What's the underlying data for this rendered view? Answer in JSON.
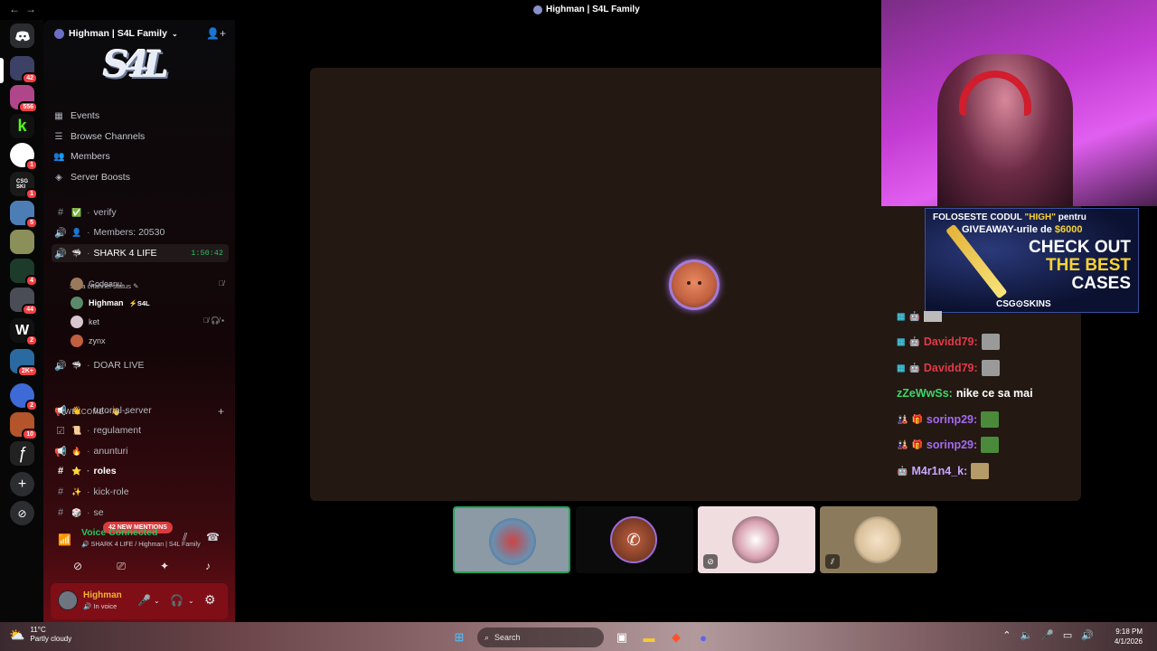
{
  "window": {
    "title": "Highman | S4L Family",
    "back": "←",
    "forward": "→"
  },
  "rail": {
    "badges": [
      "42",
      "556",
      "1",
      "1",
      "5",
      "4",
      "44",
      "2",
      "2K+",
      "2",
      "10"
    ]
  },
  "sidebar": {
    "server_name": "Highman | S4L Family",
    "banner_text": "S4L",
    "menu": [
      {
        "label": "Events",
        "icon": "calendar-icon"
      },
      {
        "label": "Browse Channels",
        "icon": "browse-icon"
      },
      {
        "label": "Members",
        "icon": "members-icon"
      },
      {
        "label": "Server Boosts",
        "icon": "boost-icon"
      }
    ],
    "channels": {
      "verify": "verify",
      "members_count": "Members: 20530",
      "shark": "SHARK 4 LIFE",
      "shark_timer": "1:50:42",
      "shark_status": "Set a channel status",
      "doar_live": "DOAR LIVE"
    },
    "voice_users": [
      {
        "name": "Godeanu",
        "tag": ""
      },
      {
        "name": "Highman",
        "tag": "⚡S4L"
      },
      {
        "name": "ket",
        "tag": ""
      },
      {
        "name": "zynx",
        "tag": ""
      }
    ],
    "category": "WELCOME - 👋",
    "welcome_channels": [
      "tutorial-server",
      "regulament",
      "anunturi",
      "roles",
      "kick-role",
      "se"
    ],
    "mentions_pill": "42 NEW MENTIONS"
  },
  "voice_panel": {
    "title": "Voice Connected",
    "subtitle": "SHARK 4 LIFE / Highman | S4L Family"
  },
  "user": {
    "name": "Highman",
    "status": "In voice"
  },
  "ad": {
    "line1_pre": "FOLOSESTE CODUL ",
    "line1_code": "\"HIGH\"",
    "line1_post": " pentru",
    "line2_pre": "GIVEAWAY-urile de ",
    "line2_amount": "$6000",
    "cta1": "CHECK OUT",
    "cta2": "THE BEST",
    "cta3": "CASES",
    "brand": "CSG⊙SKINS"
  },
  "chat": [
    {
      "user": "Davidd79:",
      "text": "",
      "color": "#e0394a"
    },
    {
      "user": "Davidd79:",
      "text": "",
      "color": "#e0394a"
    },
    {
      "user": "zZeWwSs:",
      "text": "nike ce sa mai",
      "color": "#3ed66b"
    },
    {
      "user": "sorinp29:",
      "text": "",
      "color": "#a36bf0"
    },
    {
      "user": "sorinp29:",
      "text": "",
      "color": "#a36bf0"
    },
    {
      "user": "M4r1n4_k:",
      "text": "",
      "color": "#c9a6ff"
    }
  ],
  "taskbar": {
    "temp": "11°C",
    "weather": "Partly cloudy",
    "search": "Search",
    "time": "9:18 PM",
    "date": "4/1/2026"
  },
  "colors": {
    "accent": "#23c55e",
    "mention": "#d83c3e",
    "userbar": "#7f0e17"
  }
}
